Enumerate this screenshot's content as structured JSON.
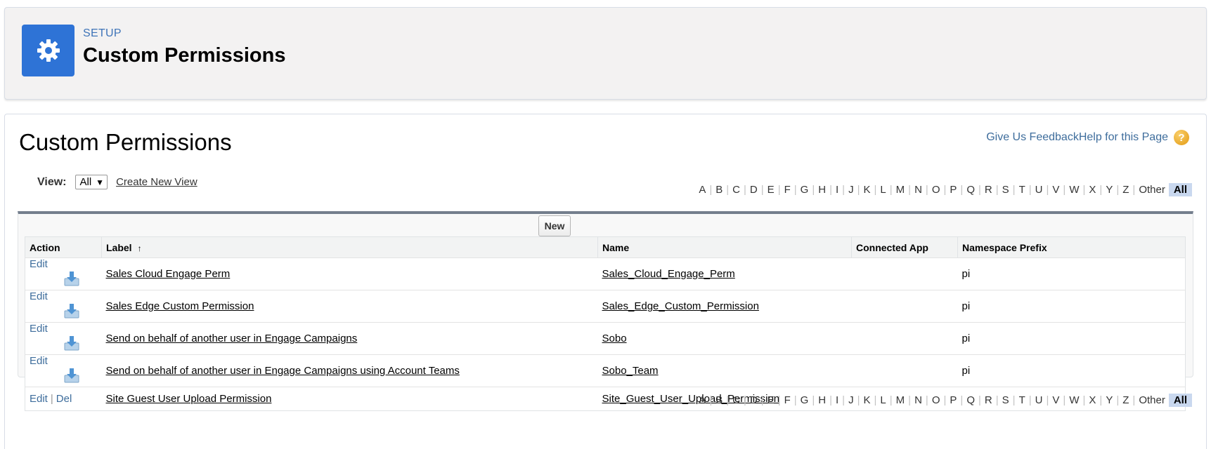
{
  "header": {
    "setup_label": "SETUP",
    "title": "Custom Permissions",
    "icon": "gear-icon",
    "icon_color": "#2e73d6"
  },
  "page": {
    "title": "Custom Permissions",
    "feedback_link": "Give Us Feedback",
    "help_link": "Help for this Page",
    "help_icon": "question-icon"
  },
  "view": {
    "label": "View:",
    "selected": "All",
    "create_new_view": "Create New View"
  },
  "alphabet": {
    "letters": [
      "A",
      "B",
      "C",
      "D",
      "E",
      "F",
      "G",
      "H",
      "I",
      "J",
      "K",
      "L",
      "M",
      "N",
      "O",
      "P",
      "Q",
      "R",
      "S",
      "T",
      "U",
      "V",
      "W",
      "X",
      "Y",
      "Z"
    ],
    "other": "Other",
    "all": "All"
  },
  "list": {
    "new_button": "New",
    "columns": {
      "action": "Action",
      "label": "Label",
      "name": "Name",
      "connected_app": "Connected App",
      "namespace_prefix": "Namespace Prefix"
    },
    "rows": [
      {
        "edit": "Edit",
        "del": "",
        "label": "Sales Cloud Engage Perm",
        "name": "Sales_Cloud_Engage_Perm",
        "connected_app": "",
        "namespace": "pi",
        "installed_icon": true
      },
      {
        "edit": "Edit",
        "del": "",
        "label": "Sales Edge Custom Permission",
        "name": "Sales_Edge_Custom_Permission",
        "connected_app": "",
        "namespace": "pi",
        "installed_icon": true
      },
      {
        "edit": "Edit",
        "del": "",
        "label": "Send on behalf of another user in Engage Campaigns",
        "name": "Sobo",
        "connected_app": "",
        "namespace": "pi",
        "installed_icon": true
      },
      {
        "edit": "Edit",
        "del": "",
        "label": "Send on behalf of another user in Engage Campaigns using Account Teams",
        "name": "Sobo_Team",
        "connected_app": "",
        "namespace": "pi",
        "installed_icon": true
      },
      {
        "edit": "Edit",
        "del": "Del",
        "label": "Site Guest User Upload Permission",
        "name": "Site_Guest_User_Upload_Permission",
        "connected_app": "",
        "namespace": "",
        "installed_icon": false
      }
    ]
  }
}
